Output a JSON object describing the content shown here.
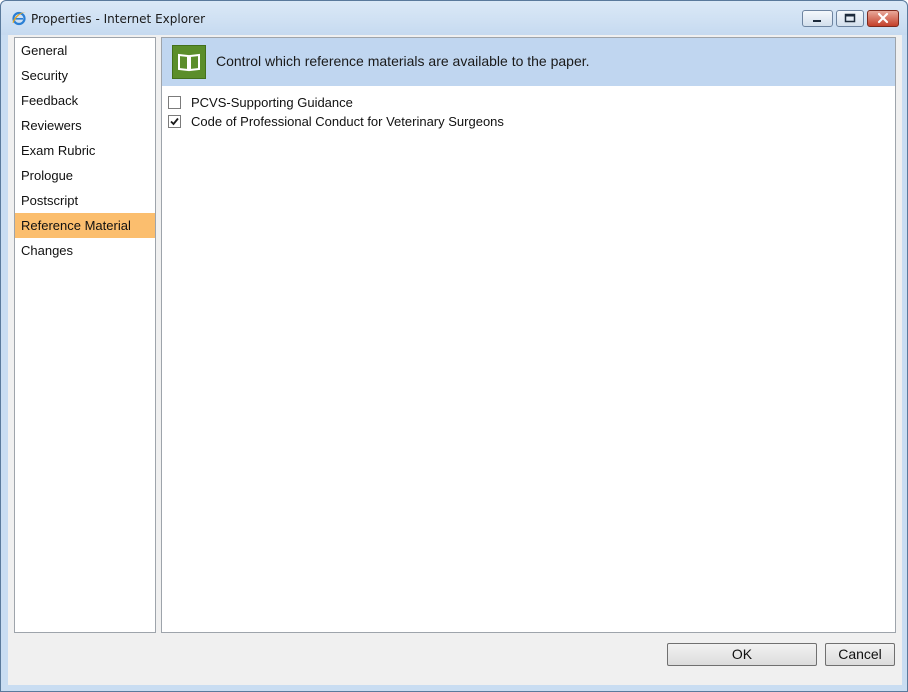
{
  "window": {
    "title": "Properties - Internet Explorer",
    "icon": "internet-explorer-icon"
  },
  "sidebar": {
    "items": [
      {
        "label": "General",
        "active": false
      },
      {
        "label": "Security",
        "active": false
      },
      {
        "label": "Feedback",
        "active": false
      },
      {
        "label": "Reviewers",
        "active": false
      },
      {
        "label": "Exam Rubric",
        "active": false
      },
      {
        "label": "Prologue",
        "active": false
      },
      {
        "label": "Postscript",
        "active": false
      },
      {
        "label": "Reference Material",
        "active": true
      },
      {
        "label": "Changes",
        "active": false
      }
    ]
  },
  "main": {
    "banner": {
      "icon": "open-book-icon",
      "text": "Control which reference materials are available to the paper."
    },
    "materials": [
      {
        "label": "PCVS-Supporting Guidance",
        "checked": false
      },
      {
        "label": "Code of Professional Conduct for Veterinary Surgeons",
        "checked": true
      }
    ]
  },
  "footer": {
    "ok_label": "OK",
    "cancel_label": "Cancel"
  },
  "colors": {
    "active_item": "#fbbe6e",
    "banner_bg": "#c0d6f0",
    "banner_icon_bg": "#5b8e2a"
  }
}
